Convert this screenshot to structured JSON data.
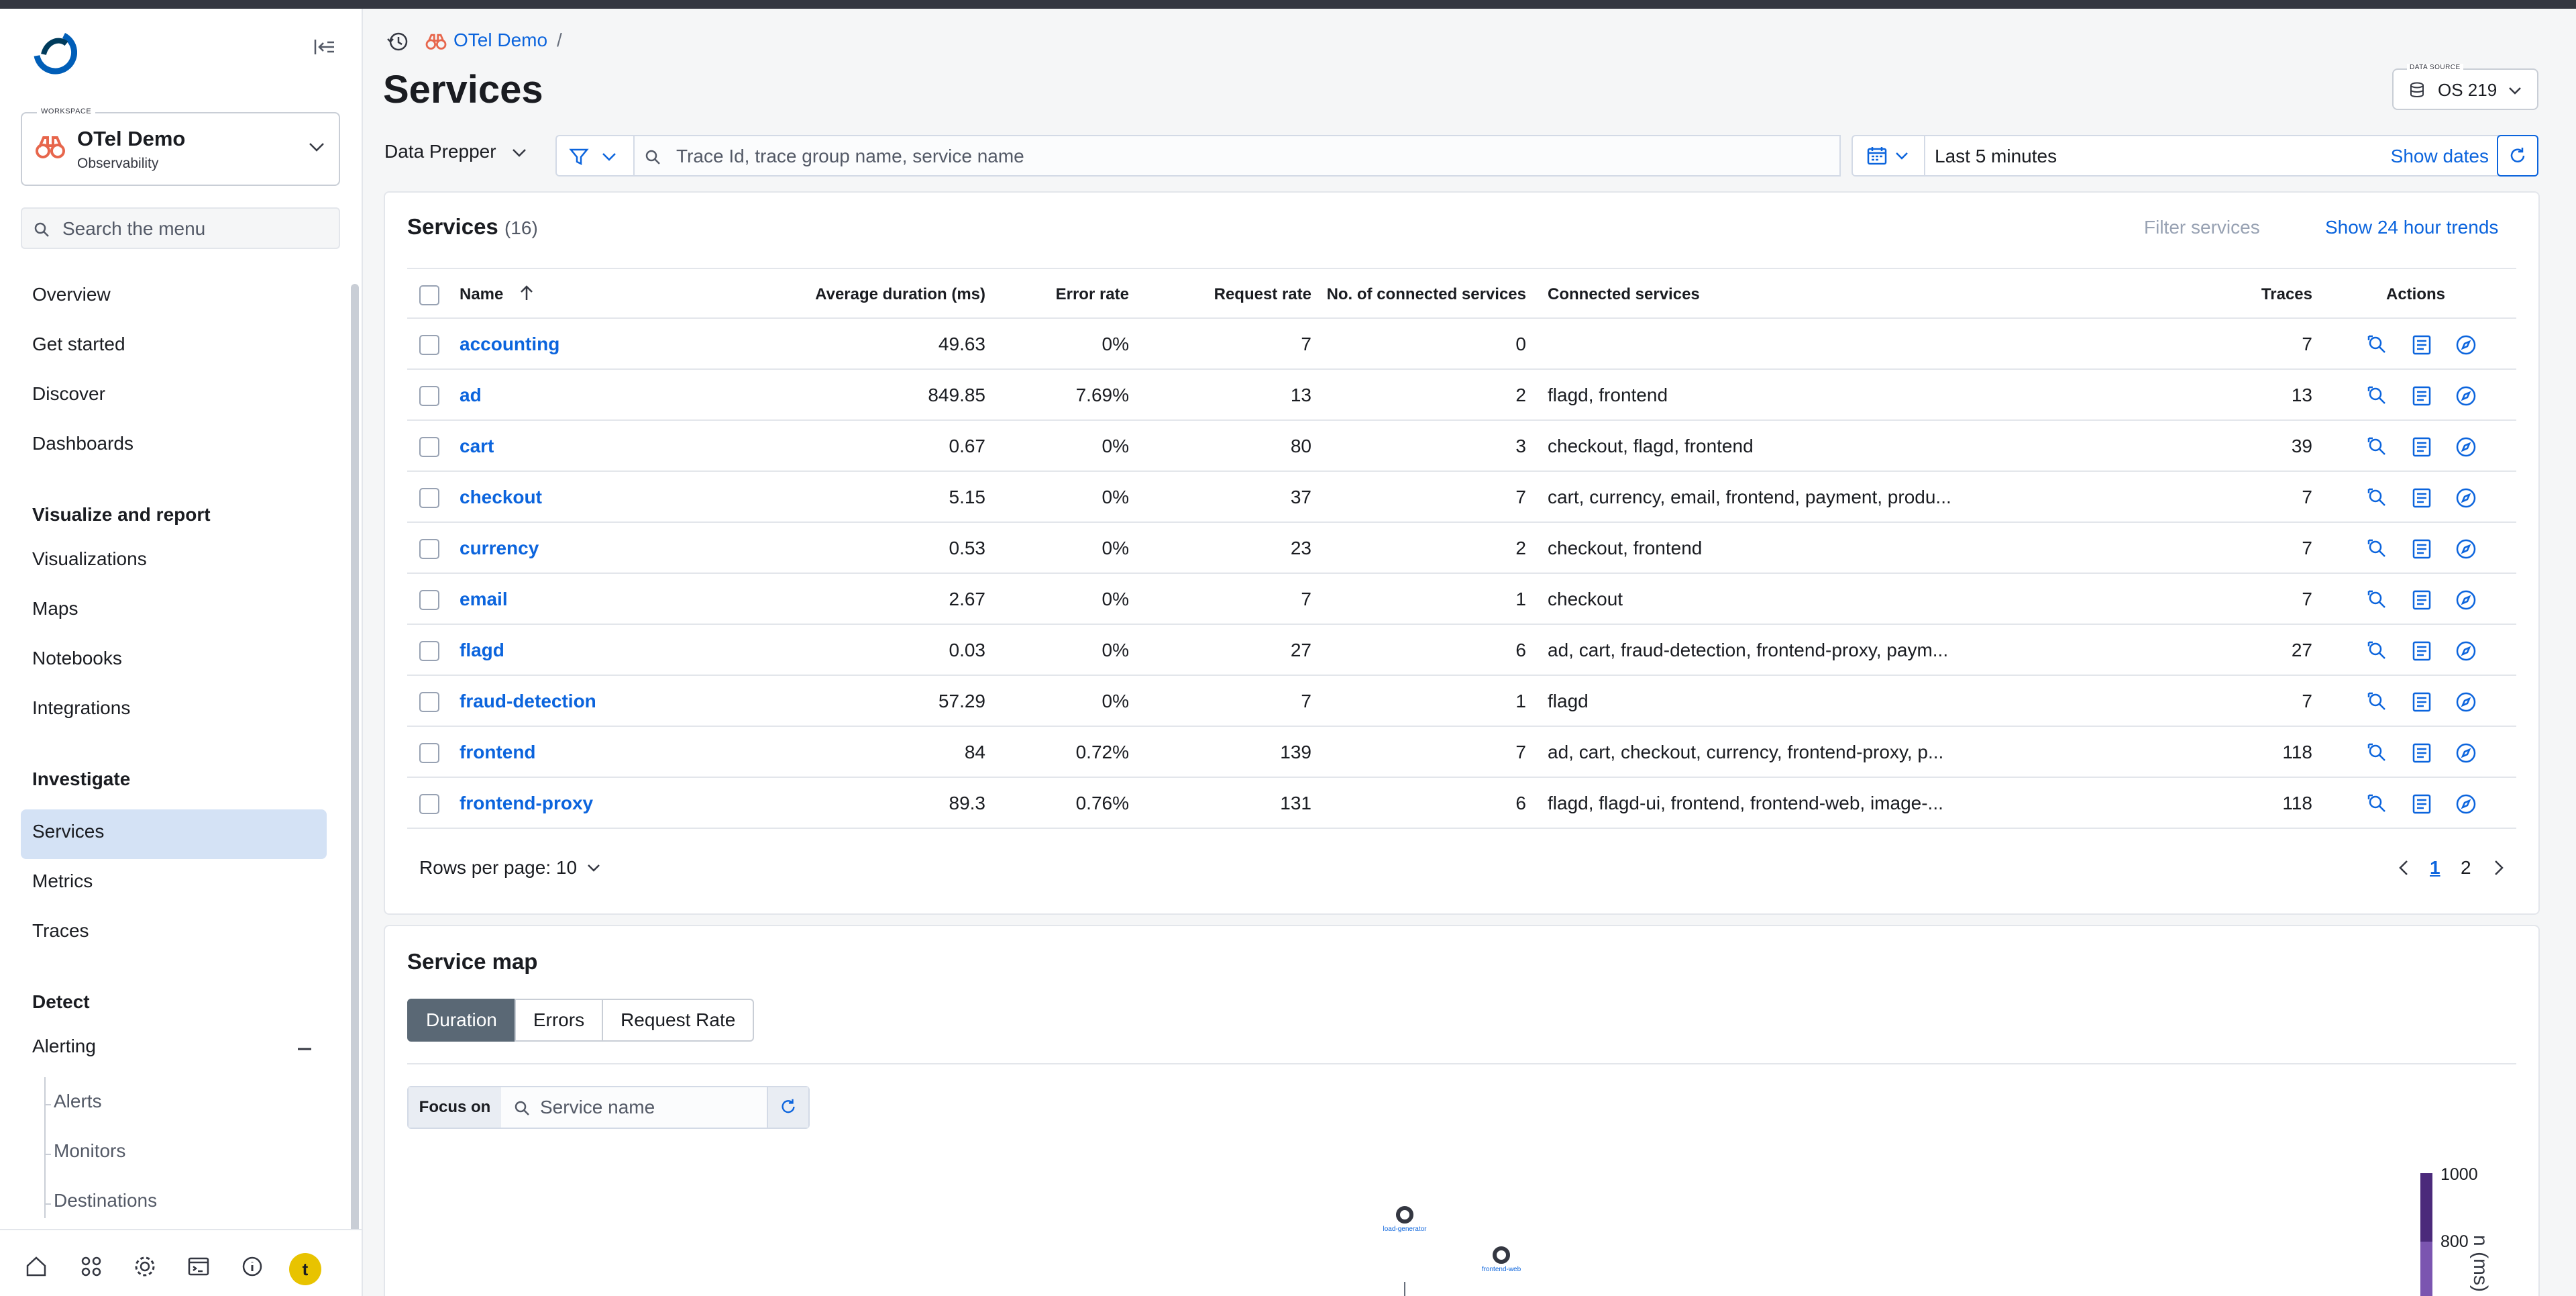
{
  "sidebar": {
    "workspace": {
      "label": "WORKSPACE",
      "name": "OTel Demo",
      "subtitle": "Observability"
    },
    "search_placeholder": "Search the menu",
    "items": {
      "overview": "Overview",
      "get_started": "Get started",
      "discover": "Discover",
      "dashboards": "Dashboards",
      "group_visualize": "Visualize and report",
      "visualizations": "Visualizations",
      "maps": "Maps",
      "notebooks": "Notebooks",
      "integrations": "Integrations",
      "group_investigate": "Investigate",
      "services": "Services",
      "metrics": "Metrics",
      "traces": "Traces",
      "group_detect": "Detect",
      "alerting": "Alerting",
      "alerts": "Alerts",
      "monitors": "Monitors",
      "destinations": "Destinations"
    },
    "avatar_letter": "t"
  },
  "header": {
    "breadcrumb_workspace": "OTel Demo",
    "breadcrumb_sep": "/",
    "title": "Services",
    "datasource_label": "DATA SOURCE",
    "datasource_value": "OS 219"
  },
  "query": {
    "language": "Data Prepper",
    "placeholder": "Trace Id, trace group name, service name",
    "date_range": "Last 5 minutes",
    "show_dates": "Show dates"
  },
  "services": {
    "title": "Services",
    "count": "(16)",
    "filter_placeholder": "Filter services",
    "trends_link": "Show 24 hour trends",
    "columns": {
      "name": "Name",
      "avg_duration": "Average duration (ms)",
      "error_rate": "Error rate",
      "request_rate": "Request rate",
      "connected_count": "No. of connected services",
      "connected": "Connected services",
      "traces": "Traces",
      "actions": "Actions"
    },
    "rows": [
      {
        "name": "accounting",
        "avg": "49.63",
        "err": "0%",
        "req": "7",
        "conn_n": "0",
        "conn": "",
        "traces": "7"
      },
      {
        "name": "ad",
        "avg": "849.85",
        "err": "7.69%",
        "req": "13",
        "conn_n": "2",
        "conn": "flagd, frontend",
        "traces": "13"
      },
      {
        "name": "cart",
        "avg": "0.67",
        "err": "0%",
        "req": "80",
        "conn_n": "3",
        "conn": "checkout, flagd, frontend",
        "traces": "39"
      },
      {
        "name": "checkout",
        "avg": "5.15",
        "err": "0%",
        "req": "37",
        "conn_n": "7",
        "conn": "cart, currency, email, frontend, payment, produ...",
        "traces": "7"
      },
      {
        "name": "currency",
        "avg": "0.53",
        "err": "0%",
        "req": "23",
        "conn_n": "2",
        "conn": "checkout, frontend",
        "traces": "7"
      },
      {
        "name": "email",
        "avg": "2.67",
        "err": "0%",
        "req": "7",
        "conn_n": "1",
        "conn": "checkout",
        "traces": "7"
      },
      {
        "name": "flagd",
        "avg": "0.03",
        "err": "0%",
        "req": "27",
        "conn_n": "6",
        "conn": "ad, cart, fraud-detection, frontend-proxy, paym...",
        "traces": "27"
      },
      {
        "name": "fraud-detection",
        "avg": "57.29",
        "err": "0%",
        "req": "7",
        "conn_n": "1",
        "conn": "flagd",
        "traces": "7"
      },
      {
        "name": "frontend",
        "avg": "84",
        "err": "0.72%",
        "req": "139",
        "conn_n": "7",
        "conn": "ad, cart, checkout, currency, frontend-proxy, p...",
        "traces": "118"
      },
      {
        "name": "frontend-proxy",
        "avg": "89.3",
        "err": "0.76%",
        "req": "131",
        "conn_n": "6",
        "conn": "flagd, flagd-ui, frontend, frontend-web, image-...",
        "traces": "118"
      }
    ],
    "rows_per_page": "Rows per page: 10",
    "pages": [
      "1",
      "2"
    ]
  },
  "service_map": {
    "title": "Service map",
    "tabs": [
      "Duration",
      "Errors",
      "Request Rate"
    ],
    "focus_label": "Focus on",
    "focus_placeholder": "Service name",
    "nodes": [
      "load-generator",
      "frontend-web"
    ],
    "legend_values": [
      "1000",
      "800"
    ],
    "legend_axis": "n (ms)"
  },
  "colors": {
    "accent": "#0b64dd",
    "active_nav": "#d4e2f5",
    "legend_dark": "#4b2a7b",
    "legend_mid": "#7b55b0"
  }
}
